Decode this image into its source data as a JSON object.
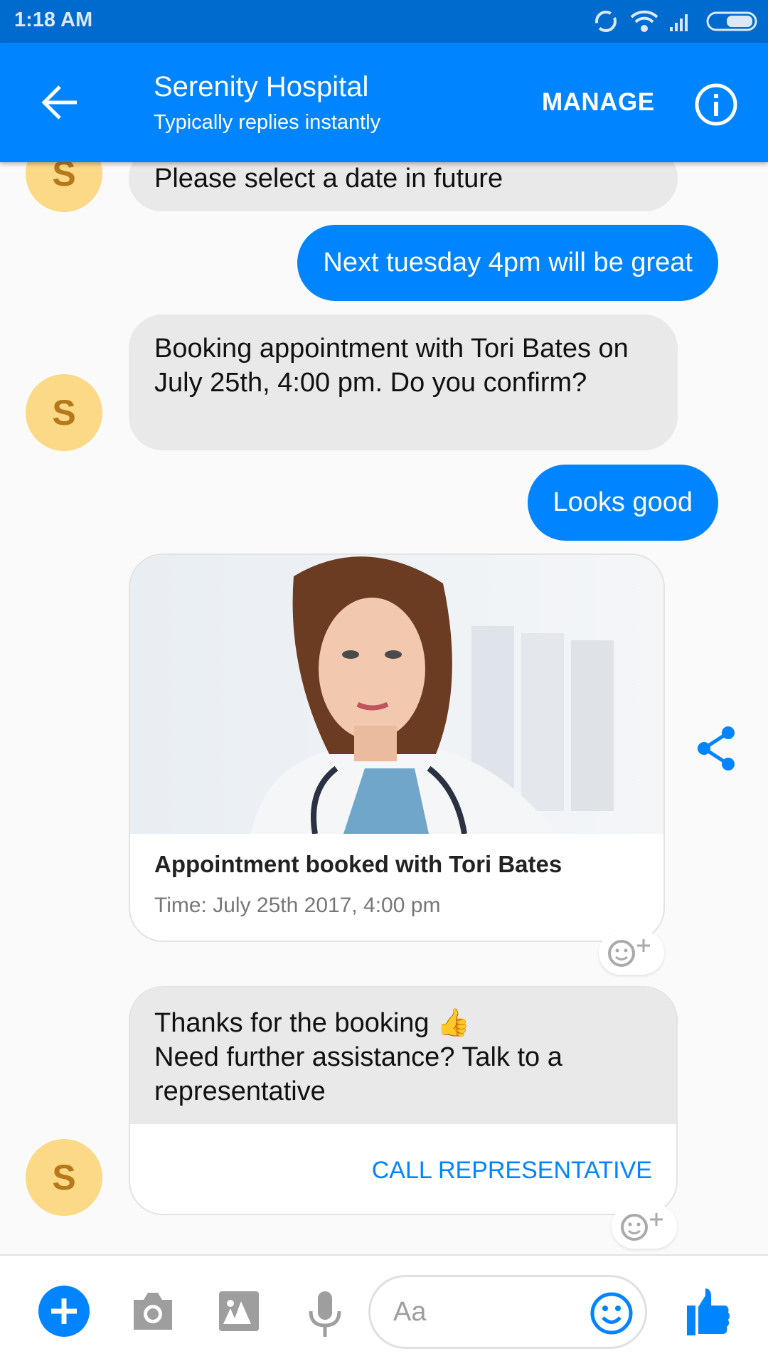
{
  "status_bar": {
    "time": "1:18 AM"
  },
  "header": {
    "title": "Serenity Hospital",
    "subtitle": "Typically replies instantly",
    "manage_label": "MANAGE"
  },
  "avatar_letter": "S",
  "messages": [
    {
      "from": "bot",
      "text": "Please select a date in future"
    },
    {
      "from": "user",
      "text": "Next tuesday 4pm will be great"
    },
    {
      "from": "bot",
      "text": "Booking appointment with Tori Bates on July 25th, 4:00 pm. Do you confirm?"
    },
    {
      "from": "user",
      "text": "Looks good"
    }
  ],
  "card": {
    "title": "Appointment booked with Tori Bates",
    "subtitle": "Time: July 25th 2017, 4:00 pm"
  },
  "final_message": {
    "line1": "Thanks for the booking",
    "emoji": "👍",
    "line2": "Need further assistance? Talk to a representative",
    "button": "CALL REPRESENTATIVE"
  },
  "composer": {
    "placeholder": "Aa"
  },
  "colors": {
    "accent": "#0084ff",
    "status": "#006bce",
    "avatar": "#fcd986"
  }
}
